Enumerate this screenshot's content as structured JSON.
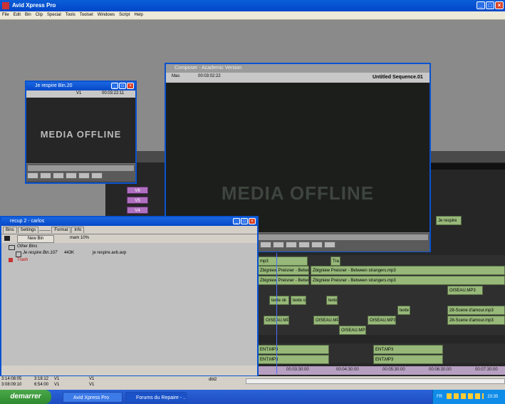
{
  "app_title": "Avid Xpress Pro",
  "menu": [
    "File",
    "Edit",
    "Bin",
    "Clip",
    "Special",
    "Tools",
    "Toolset",
    "Windows",
    "Script",
    "Help"
  ],
  "source_window": {
    "title": "Je respire Bin.20",
    "track": "V1",
    "timecode": "00:03:22:11",
    "offline": "MEDIA OFFLINE"
  },
  "composer": {
    "title": "Composer - Academic Version",
    "label_left": "Mas",
    "timecode": "00:03:02:22",
    "sequence": "Untitled Sequence.01",
    "offline": "MEDIA OFFLINE"
  },
  "track_labels": [
    "V6",
    "V5",
    "V4"
  ],
  "bin_window": {
    "title": "recup 2 - carlos",
    "tabs": [
      "Bins",
      "Settings",
      "",
      "Format",
      "Info"
    ],
    "new_bin": "New Bin",
    "sort_label": "mam 10%",
    "other_bins": "Other Bins",
    "row": {
      "name": "Je respire Bin.107",
      "size": "443K",
      "file": "je respire.avb.avp"
    },
    "trash": "Trash"
  },
  "timeline": {
    "clips": {
      "je_respire": "Je respire",
      "mp3_a": "mp3",
      "tra": "Tra",
      "zb1": "Zbigniew Preisner - Between st",
      "zb2": "Zbigniew Preisner - Between strangers.mp3",
      "zb3": "Zbigniew Preisner - Between st",
      "zb4": "Zbigniew Preisner - Between strangers.mp3",
      "oiseau1": "OISEAU.MP3",
      "texte1": "texte ok",
      "texte2": "texte ok",
      "texte3": "texte",
      "texte4": "texte",
      "scene1": "28-Scene d'amour.mp3",
      "scene2": "28-Scene d'amour.mp3",
      "oiseau2": "OISEAU.MP3",
      "oiseau3": "OISEAU.MP3",
      "oiseau4": "OISEAU.MP3",
      "oiseau5": "OISEAU.MP3",
      "ent1": "ENT.MP3",
      "ent2": "ENT.MP3",
      "ent3": "ENT.MP3",
      "ent4": "ENT.MP3"
    },
    "ruler": [
      "00:03:30:00",
      "00:04:30:00",
      "00:05:30:00",
      "00:06:30:00",
      "00:07:30:00"
    ],
    "left_rows": [
      {
        "a": "3:14:08:05",
        "b": "3:18:12",
        "c": "V1",
        "d": "V1"
      },
      {
        "a": "3:08:09:10",
        "b": "6:54:00",
        "c": "V1",
        "d": "V1"
      }
    ],
    "bottom_label": "dbl2"
  },
  "taskbar": {
    "start": "demarrer",
    "tasks": [
      "Avid Xpress Pro",
      "Forums du Repaire - ..."
    ],
    "lang": "FR",
    "clock": "23:35"
  }
}
